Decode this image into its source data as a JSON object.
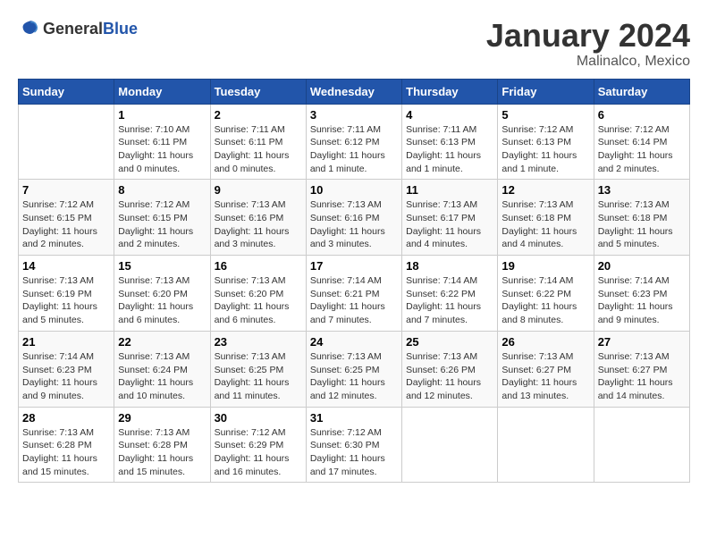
{
  "logo": {
    "general": "General",
    "blue": "Blue"
  },
  "title": "January 2024",
  "location": "Malinalco, Mexico",
  "weekdays": [
    "Sunday",
    "Monday",
    "Tuesday",
    "Wednesday",
    "Thursday",
    "Friday",
    "Saturday"
  ],
  "weeks": [
    [
      {
        "day": "",
        "info": ""
      },
      {
        "day": "1",
        "info": "Sunrise: 7:10 AM\nSunset: 6:11 PM\nDaylight: 11 hours\nand 0 minutes."
      },
      {
        "day": "2",
        "info": "Sunrise: 7:11 AM\nSunset: 6:11 PM\nDaylight: 11 hours\nand 0 minutes."
      },
      {
        "day": "3",
        "info": "Sunrise: 7:11 AM\nSunset: 6:12 PM\nDaylight: 11 hours\nand 1 minute."
      },
      {
        "day": "4",
        "info": "Sunrise: 7:11 AM\nSunset: 6:13 PM\nDaylight: 11 hours\nand 1 minute."
      },
      {
        "day": "5",
        "info": "Sunrise: 7:12 AM\nSunset: 6:13 PM\nDaylight: 11 hours\nand 1 minute."
      },
      {
        "day": "6",
        "info": "Sunrise: 7:12 AM\nSunset: 6:14 PM\nDaylight: 11 hours\nand 2 minutes."
      }
    ],
    [
      {
        "day": "7",
        "info": "Sunrise: 7:12 AM\nSunset: 6:15 PM\nDaylight: 11 hours\nand 2 minutes."
      },
      {
        "day": "8",
        "info": "Sunrise: 7:12 AM\nSunset: 6:15 PM\nDaylight: 11 hours\nand 2 minutes."
      },
      {
        "day": "9",
        "info": "Sunrise: 7:13 AM\nSunset: 6:16 PM\nDaylight: 11 hours\nand 3 minutes."
      },
      {
        "day": "10",
        "info": "Sunrise: 7:13 AM\nSunset: 6:16 PM\nDaylight: 11 hours\nand 3 minutes."
      },
      {
        "day": "11",
        "info": "Sunrise: 7:13 AM\nSunset: 6:17 PM\nDaylight: 11 hours\nand 4 minutes."
      },
      {
        "day": "12",
        "info": "Sunrise: 7:13 AM\nSunset: 6:18 PM\nDaylight: 11 hours\nand 4 minutes."
      },
      {
        "day": "13",
        "info": "Sunrise: 7:13 AM\nSunset: 6:18 PM\nDaylight: 11 hours\nand 5 minutes."
      }
    ],
    [
      {
        "day": "14",
        "info": "Sunrise: 7:13 AM\nSunset: 6:19 PM\nDaylight: 11 hours\nand 5 minutes."
      },
      {
        "day": "15",
        "info": "Sunrise: 7:13 AM\nSunset: 6:20 PM\nDaylight: 11 hours\nand 6 minutes."
      },
      {
        "day": "16",
        "info": "Sunrise: 7:13 AM\nSunset: 6:20 PM\nDaylight: 11 hours\nand 6 minutes."
      },
      {
        "day": "17",
        "info": "Sunrise: 7:14 AM\nSunset: 6:21 PM\nDaylight: 11 hours\nand 7 minutes."
      },
      {
        "day": "18",
        "info": "Sunrise: 7:14 AM\nSunset: 6:22 PM\nDaylight: 11 hours\nand 7 minutes."
      },
      {
        "day": "19",
        "info": "Sunrise: 7:14 AM\nSunset: 6:22 PM\nDaylight: 11 hours\nand 8 minutes."
      },
      {
        "day": "20",
        "info": "Sunrise: 7:14 AM\nSunset: 6:23 PM\nDaylight: 11 hours\nand 9 minutes."
      }
    ],
    [
      {
        "day": "21",
        "info": "Sunrise: 7:14 AM\nSunset: 6:23 PM\nDaylight: 11 hours\nand 9 minutes."
      },
      {
        "day": "22",
        "info": "Sunrise: 7:13 AM\nSunset: 6:24 PM\nDaylight: 11 hours\nand 10 minutes."
      },
      {
        "day": "23",
        "info": "Sunrise: 7:13 AM\nSunset: 6:25 PM\nDaylight: 11 hours\nand 11 minutes."
      },
      {
        "day": "24",
        "info": "Sunrise: 7:13 AM\nSunset: 6:25 PM\nDaylight: 11 hours\nand 12 minutes."
      },
      {
        "day": "25",
        "info": "Sunrise: 7:13 AM\nSunset: 6:26 PM\nDaylight: 11 hours\nand 12 minutes."
      },
      {
        "day": "26",
        "info": "Sunrise: 7:13 AM\nSunset: 6:27 PM\nDaylight: 11 hours\nand 13 minutes."
      },
      {
        "day": "27",
        "info": "Sunrise: 7:13 AM\nSunset: 6:27 PM\nDaylight: 11 hours\nand 14 minutes."
      }
    ],
    [
      {
        "day": "28",
        "info": "Sunrise: 7:13 AM\nSunset: 6:28 PM\nDaylight: 11 hours\nand 15 minutes."
      },
      {
        "day": "29",
        "info": "Sunrise: 7:13 AM\nSunset: 6:28 PM\nDaylight: 11 hours\nand 15 minutes."
      },
      {
        "day": "30",
        "info": "Sunrise: 7:12 AM\nSunset: 6:29 PM\nDaylight: 11 hours\nand 16 minutes."
      },
      {
        "day": "31",
        "info": "Sunrise: 7:12 AM\nSunset: 6:30 PM\nDaylight: 11 hours\nand 17 minutes."
      },
      {
        "day": "",
        "info": ""
      },
      {
        "day": "",
        "info": ""
      },
      {
        "day": "",
        "info": ""
      }
    ]
  ]
}
